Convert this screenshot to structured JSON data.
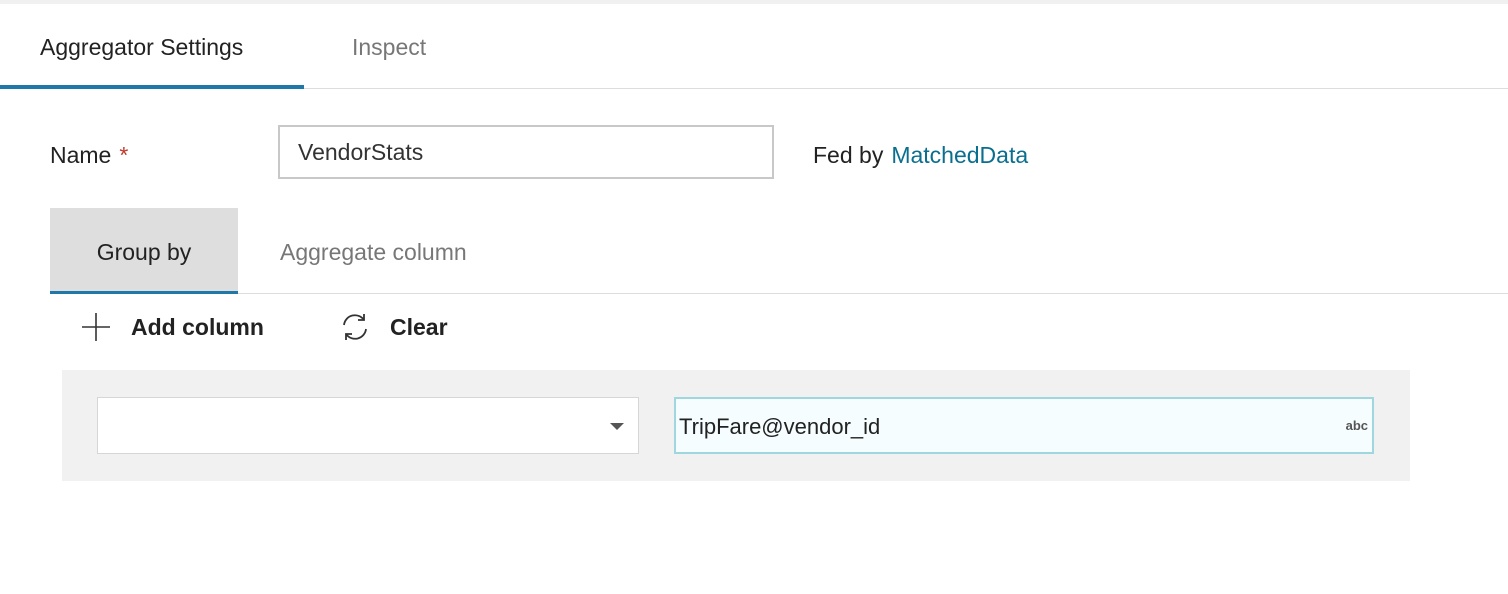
{
  "tabs": {
    "settings": "Aggregator Settings",
    "inspect": "Inspect"
  },
  "form": {
    "name_label": "Name",
    "required_mark": "*",
    "name_value": "VendorStats",
    "fed_by_label": "Fed by",
    "fed_by_link": "MatchedData"
  },
  "subtabs": {
    "group_by": "Group by",
    "aggregate_column": "Aggregate column"
  },
  "toolbar": {
    "add_column": "Add column",
    "clear": "Clear"
  },
  "group_row": {
    "column_select_value": "",
    "expression": "TripFare@vendor_id",
    "type_badge": "abc"
  },
  "colors": {
    "accent": "#1f78a8",
    "link": "#0a6f8f",
    "required": "#c0392b"
  }
}
